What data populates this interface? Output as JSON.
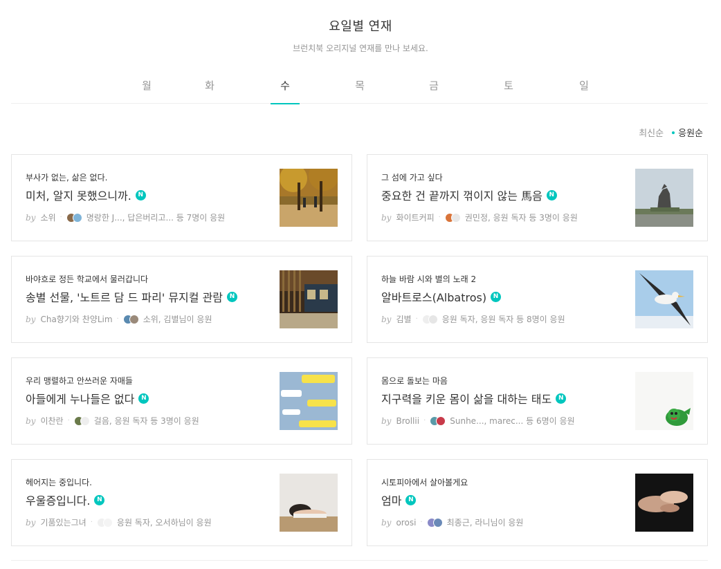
{
  "header": {
    "title": "요일별 연재",
    "subtitle": "브런치북 오리지널 연재를 만나 보세요."
  },
  "tabs": [
    {
      "label": "월",
      "active": false
    },
    {
      "label": "화",
      "active": false
    },
    {
      "label": "수",
      "active": true
    },
    {
      "label": "목",
      "active": false
    },
    {
      "label": "금",
      "active": false
    },
    {
      "label": "토",
      "active": false
    },
    {
      "label": "일",
      "active": false
    }
  ],
  "sort": {
    "latest_label": "최신순",
    "popular_label": "응원순"
  },
  "badge_label": "N",
  "by_label": "by",
  "colors": {
    "accent": "#00c6be",
    "text": "#333333",
    "muted": "#959595",
    "border": "#e5e5e5"
  },
  "cards": [
    {
      "subtitle": "부사가 없는, 삶은 없다.",
      "title": "미처, 알지 못했으니까.",
      "author": "소위",
      "supporters": "명랑한 J..., 답은버리고... 등 7명이 응원",
      "thumb_icon": "autumn-park-image"
    },
    {
      "subtitle": "그 섬에 가고 싶다",
      "title": "중요한 건 끝까지 꺾이지 않는 馬음",
      "author": "화이트커피",
      "supporters": "권민정, 응원 독자 등 3명이 응원",
      "thumb_icon": "horse-statue-image"
    },
    {
      "subtitle": "바야흐로 정든 학교에서 물러갑니다",
      "title": "송별 선물, '노트르 담 드 파리' 뮤지컬 관람",
      "author": "Cha향기와 찬양Lim",
      "supporters": "소위, 김별님이 응원",
      "thumb_icon": "theater-lobby-image"
    },
    {
      "subtitle": "하늘 바람 시와 별의 노래 2",
      "title": "알바트로스(Albatros)",
      "author": "김별",
      "supporters": "응원 독자, 응원 독자 등 8명이 응원",
      "thumb_icon": "albatross-image"
    },
    {
      "subtitle": "우리 맹렬하고 안쓰러운 자매들",
      "title": "아들에게 누나들은 없다",
      "author": "이찬란",
      "supporters": "걸음, 응원 독자 등 3명이 응원",
      "thumb_icon": "chat-screenshot-image"
    },
    {
      "subtitle": "몸으로 돌보는 마음",
      "title": "지구력을 키운 몸이 삶을 대하는 태도",
      "author": "Brollii",
      "supporters": "Sunhe..., marec... 등 6명이 응원",
      "thumb_icon": "green-character-image"
    },
    {
      "subtitle": "헤어지는 중입니다.",
      "title": "우울증입니다.",
      "author": "기품있는그녀",
      "supporters": "응원 독자, 오서하님이 응원",
      "thumb_icon": "resting-person-image"
    },
    {
      "subtitle": "시토피아에서 살아볼게요",
      "title": "엄마",
      "author": "orosi",
      "supporters": "최종근, 라니님이 응원",
      "thumb_icon": "holding-hands-image"
    }
  ]
}
